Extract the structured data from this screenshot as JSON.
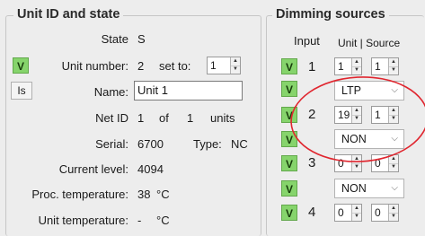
{
  "unit_panel": {
    "title": "Unit ID and state",
    "state_label": "State",
    "state_value": "S",
    "v_label": "V",
    "unit_number_label": "Unit number:",
    "unit_number_value": "2",
    "set_to_label": "set to:",
    "set_to_value": "1",
    "is_button": "Is",
    "name_label": "Name:",
    "name_value": "Unit 1",
    "net_id_label": "Net ID",
    "net_id_value": "1",
    "of_label": "of",
    "units_count": "1",
    "units_label": "units",
    "serial_label": "Serial:",
    "serial_value": "6700",
    "type_label": "Type:",
    "type_value": "NC",
    "current_level_label": "Current level:",
    "current_level_value": "4094",
    "proc_temp_label": "Proc. temperature:",
    "proc_temp_value": "38",
    "proc_temp_unit": "°C",
    "unit_temp_label": "Unit temperature:",
    "unit_temp_value": "-",
    "unit_temp_unit": "°C"
  },
  "dimming_panel": {
    "title": "Dimming sources",
    "input_header": "Input",
    "unit_source_header": "Unit | Source",
    "v_label": "V",
    "rows": [
      {
        "input": "1",
        "unit": "1",
        "source": "1",
        "mode": "LTP"
      },
      {
        "input": "2",
        "unit": "19",
        "source": "1",
        "mode": "NON"
      },
      {
        "input": "3",
        "unit": "0",
        "source": "0",
        "mode": "NON"
      },
      {
        "input": "4",
        "unit": "0",
        "source": "0"
      }
    ]
  },
  "annotation": {
    "color": "#e0262f"
  },
  "spinner_up_glyph": "▲",
  "spinner_down_glyph": "▼",
  "dropdown_glyph": "⌵"
}
